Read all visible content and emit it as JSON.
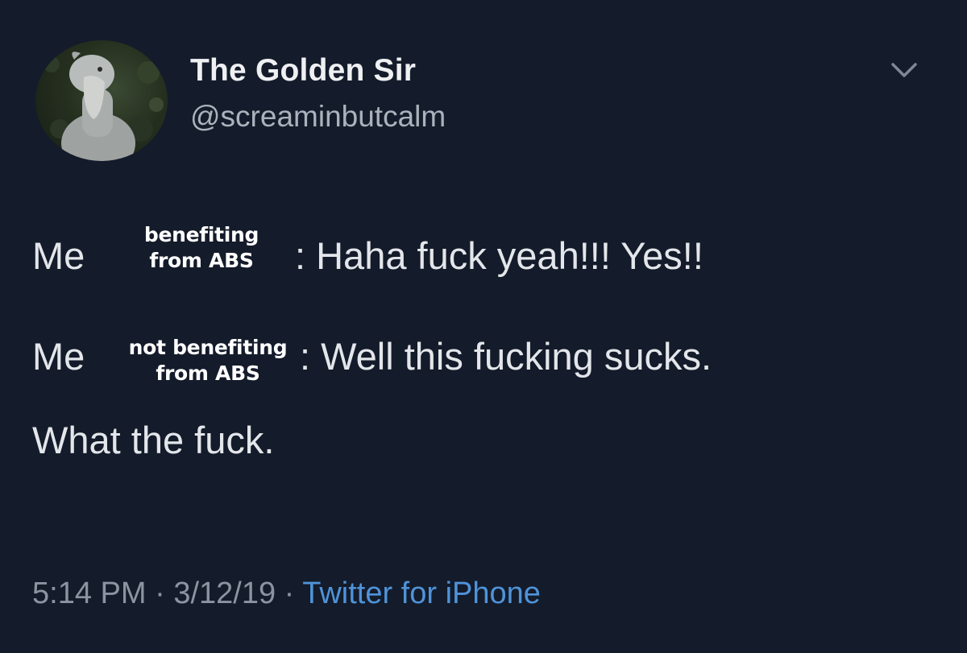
{
  "author": {
    "display_name": "The Golden Sir",
    "handle": "@screaminbutcalm",
    "avatar_icon": "shoebill-bird-avatar"
  },
  "menu": {
    "icon": "chevron-down-icon"
  },
  "tweet": {
    "line1": {
      "subject": "Me",
      "caption_line1": "benefiting",
      "caption_line2": "from ABS",
      "text": ": Haha fuck yeah!!! Yes!!"
    },
    "line2": {
      "subject": "Me",
      "caption_line1": "not benefiting",
      "caption_line2": "from ABS",
      "text": ": Well this fucking sucks.",
      "continuation": "What the fuck."
    }
  },
  "footer": {
    "time": "5:14 PM",
    "separator": "·",
    "date": "3/12/19",
    "source": "Twitter for iPhone"
  },
  "colors": {
    "background": "#141b2a",
    "text": "#e3e6ea",
    "muted": "#8a95a1",
    "link": "#4f93d8"
  }
}
